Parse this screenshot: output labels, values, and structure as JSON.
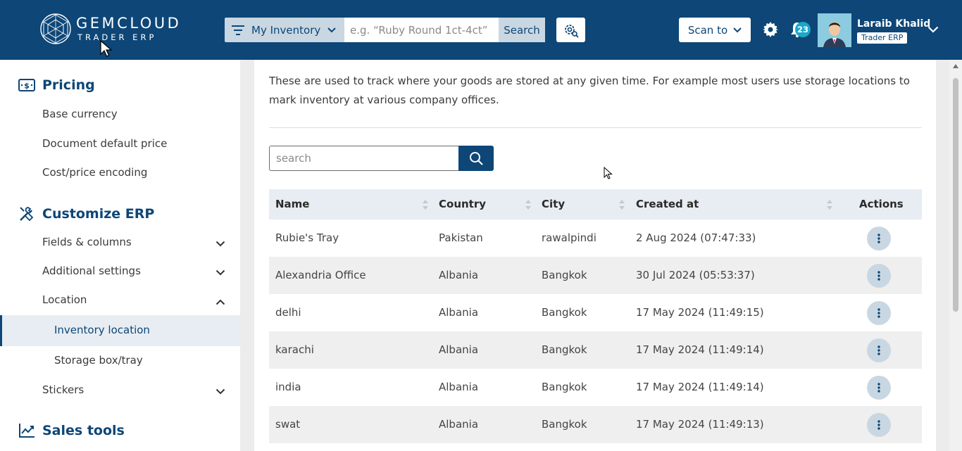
{
  "header": {
    "brand_line1": "GEMCLOUD",
    "brand_line2": "TRADER ERP",
    "filter_label": "My Inventory",
    "search_placeholder": "e.g. “Ruby Round 1ct-4ct”",
    "search_button": "Search",
    "scan_label": "Scan to",
    "notifications_count": "23",
    "user_name": "Laraib Khalid",
    "user_role": "Trader ERP",
    "brand_color": "#0d4677"
  },
  "sidebar": {
    "pricing_title": "Pricing",
    "pricing_items": [
      "Base currency",
      "Document default price",
      "Cost/price encoding"
    ],
    "customize_title": "Customize ERP",
    "customize_items": [
      "Fields & columns",
      "Additional settings",
      "Location"
    ],
    "location_sub": [
      "Inventory location",
      "Storage box/tray"
    ],
    "stickers": "Stickers",
    "sales_title": "Sales tools"
  },
  "main": {
    "description": "These are used to track where your goods are stored at any given time. For example most users use storage locations to mark inventory at various company offices.",
    "search_placeholder": "search",
    "columns": [
      "Name",
      "Country",
      "City",
      "Created at",
      "Actions"
    ],
    "rows": [
      {
        "name": "Rubie's Tray",
        "country": "Pakistan",
        "city": "rawalpindi",
        "created": "2 Aug 2024 (07:47:33)"
      },
      {
        "name": "Alexandria Office",
        "country": "Albania",
        "city": "Bangkok",
        "created": "30 Jul 2024 (05:53:37)"
      },
      {
        "name": "delhi",
        "country": "Albania",
        "city": "Bangkok",
        "created": "17 May 2024 (11:49:15)"
      },
      {
        "name": "karachi",
        "country": "Albania",
        "city": "Bangkok",
        "created": "17 May 2024 (11:49:14)"
      },
      {
        "name": "india",
        "country": "Albania",
        "city": "Bangkok",
        "created": "17 May 2024 (11:49:14)"
      },
      {
        "name": "swat",
        "country": "Albania",
        "city": "Bangkok",
        "created": "17 May 2024 (11:49:13)"
      }
    ]
  }
}
